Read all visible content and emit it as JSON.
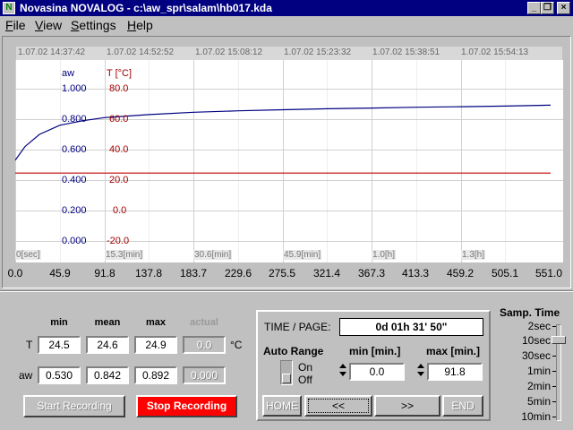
{
  "window": {
    "title": "Novasina NOVALOG - c:\\aw_spr\\salam\\hb017.kda",
    "minimize": "_",
    "maximize": "❐",
    "close": "×"
  },
  "menu": [
    "File",
    "View",
    "Settings",
    "Help"
  ],
  "chart": {
    "date_labels": [
      "1.07.02 14:37:42",
      "1.07.02 14:52:52",
      "1.07.02 15:08:12",
      "1.07.02 15:23:32",
      "1.07.02 15:38:51",
      "1.07.02 15:54:13"
    ],
    "aw_header": "aw",
    "t_header": "T [°C]",
    "aw_ticks": [
      "1.000",
      "0.800",
      "0.600",
      "0.400",
      "0.200",
      "0.000"
    ],
    "t_ticks": [
      "80.0",
      "60.0",
      "40.0",
      "20.0",
      "0.0",
      "-20.0"
    ],
    "time_labels": [
      "0[sec]",
      "15.3[min]",
      "30.6[min]",
      "45.9[min]",
      "1.0[h]",
      "1.3[h]"
    ],
    "x_ticks": [
      "0.0",
      "45.9",
      "91.8",
      "137.8",
      "183.7",
      "229.6",
      "275.5",
      "321.4",
      "367.3",
      "413.3",
      "459.2",
      "505.1",
      "551.0"
    ],
    "colors": {
      "aw_line": "#000080",
      "t_line": "#c00000",
      "grid": "#d0d0d0"
    }
  },
  "chart_data": {
    "type": "line",
    "x": [
      0,
      10,
      25,
      45.9,
      70,
      91.8,
      137.8,
      183.7,
      229.6,
      275.5,
      321.4,
      367.3,
      413.3,
      459.2,
      505.1,
      551.0
    ],
    "x_ticks": [
      "0.0",
      "45.9",
      "91.8",
      "137.8",
      "183.7",
      "229.6",
      "275.5",
      "321.4",
      "367.3",
      "413.3",
      "459.2",
      "505.1",
      "551.0"
    ],
    "xlim": [
      0,
      551.0
    ],
    "series": [
      {
        "axis": "aw",
        "values": [
          0.53,
          0.62,
          0.7,
          0.76,
          0.79,
          0.81,
          0.83,
          0.845,
          0.855,
          0.862,
          0.868,
          0.873,
          0.878,
          0.882,
          0.886,
          0.892
        ],
        "ylim": [
          0.0,
          1.0
        ]
      },
      {
        "axis": "T",
        "values": [
          24.6,
          24.6,
          24.6,
          24.6,
          24.6,
          24.6,
          24.6,
          24.6,
          24.6,
          24.6,
          24.6,
          24.6,
          24.6,
          24.6,
          24.6,
          24.6
        ],
        "ylim": [
          -20.0,
          80.0
        ]
      }
    ]
  },
  "stats": {
    "headers": {
      "min": "min",
      "mean": "mean",
      "max": "max",
      "actual": "actual"
    },
    "t_label": "T",
    "t_unit": "°C",
    "aw_label": "aw",
    "t": {
      "min": "24.5",
      "mean": "24.6",
      "max": "24.9",
      "actual": "0.0"
    },
    "aw": {
      "min": "0.530",
      "mean": "0.842",
      "max": "0.892",
      "actual": "0.000"
    }
  },
  "recording": {
    "start": "Start Recording",
    "stop": "Stop Recording"
  },
  "page": {
    "time_label": "TIME / PAGE:",
    "time_value": "0d 01h 31' 50\"",
    "auto_range": "Auto Range",
    "on": "On",
    "off": "Off",
    "min_label": "min [min.]",
    "max_label": "max [min.]",
    "min_value": "0.0",
    "max_value": "91.8",
    "home": "HOME",
    "prev": "<<",
    "next": ">>",
    "end": "END"
  },
  "sampling": {
    "title": "Samp. Time",
    "options": [
      "2sec",
      "10sec",
      "30sec",
      "1min",
      "2min",
      "5min",
      "10min"
    ],
    "selected": "10sec"
  }
}
